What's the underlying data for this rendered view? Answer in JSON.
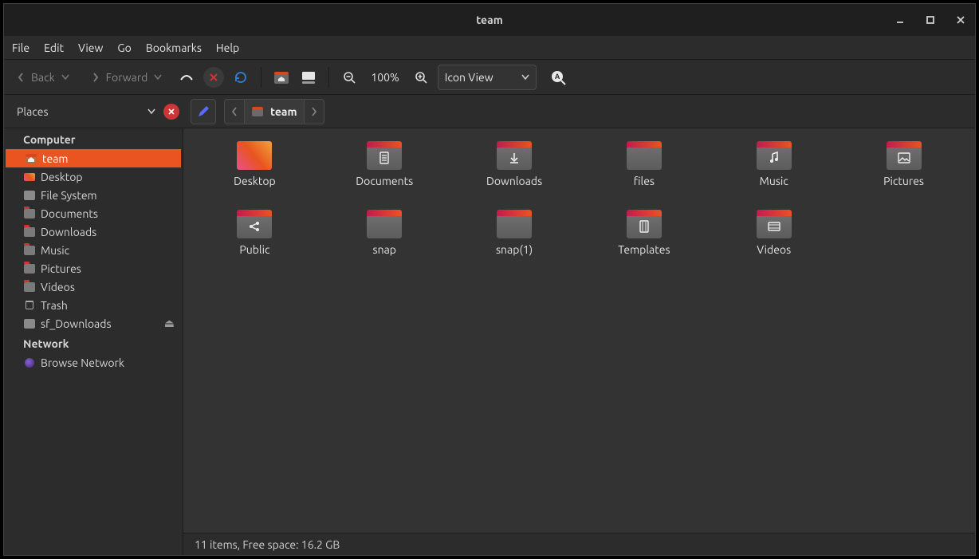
{
  "window": {
    "title": "team"
  },
  "menu": [
    "File",
    "Edit",
    "View",
    "Go",
    "Bookmarks",
    "Help"
  ],
  "toolbar": {
    "back_label": "Back",
    "forward_label": "Forward",
    "zoom_label": "100%",
    "view_mode": "Icon View"
  },
  "sidebar": {
    "places_label": "Places",
    "groups": [
      {
        "header": "Computer",
        "items": [
          {
            "label": "team",
            "icon": "home",
            "selected": true
          },
          {
            "label": "Desktop",
            "icon": "desktop"
          },
          {
            "label": "File System",
            "icon": "disk"
          },
          {
            "label": "Documents",
            "icon": "folder"
          },
          {
            "label": "Downloads",
            "icon": "folder"
          },
          {
            "label": "Music",
            "icon": "folder"
          },
          {
            "label": "Pictures",
            "icon": "folder"
          },
          {
            "label": "Videos",
            "icon": "folder"
          },
          {
            "label": "Trash",
            "icon": "trash"
          },
          {
            "label": "sf_Downloads",
            "icon": "disk",
            "ejectable": true
          }
        ]
      },
      {
        "header": "Network",
        "items": [
          {
            "label": "Browse Network",
            "icon": "network"
          }
        ]
      }
    ]
  },
  "breadcrumb": {
    "current": "team"
  },
  "files": [
    {
      "label": "Desktop",
      "type": "desktop"
    },
    {
      "label": "Documents",
      "type": "folder",
      "glyph": "doc"
    },
    {
      "label": "Downloads",
      "type": "folder",
      "glyph": "download"
    },
    {
      "label": "files",
      "type": "folder"
    },
    {
      "label": "Music",
      "type": "folder",
      "glyph": "music"
    },
    {
      "label": "Pictures",
      "type": "folder",
      "glyph": "picture"
    },
    {
      "label": "Public",
      "type": "folder",
      "glyph": "share"
    },
    {
      "label": "snap",
      "type": "folder"
    },
    {
      "label": "snap(1)",
      "type": "folder"
    },
    {
      "label": "Templates",
      "type": "folder",
      "glyph": "template"
    },
    {
      "label": "Videos",
      "type": "folder",
      "glyph": "video"
    }
  ],
  "status": {
    "text": "11 items, Free space: 16.2 GB"
  }
}
